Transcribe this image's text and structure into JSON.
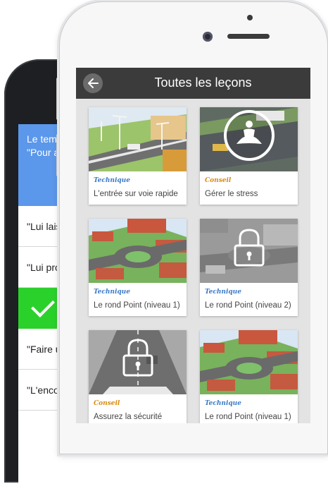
{
  "colors": {
    "technique": "#3b7bc6",
    "conseil": "#d98a12",
    "appbar": "#3b3b3b",
    "correct": "#2bd12b",
    "question_bg": "#5b97ea"
  },
  "back_phone": {
    "question_line1": "Le temp",
    "question_line2": "\"Pour ap",
    "answers": [
      "\"Lui lais",
      "\"Lui prop",
      "",
      "\"Faire u",
      "\"L'encou"
    ]
  },
  "app": {
    "title": "Toutes les leçons",
    "back_icon": "arrow-left-icon",
    "lessons": [
      {
        "tag": "Technique",
        "title": "L'entrée sur voie rapide",
        "locked": false,
        "icon": ""
      },
      {
        "tag": "Conseil",
        "title": "Gérer le stress",
        "locked": false,
        "icon": "meditation-icon"
      },
      {
        "tag": "Technique",
        "title": "Le rond Point (niveau 1)",
        "locked": false,
        "icon": ""
      },
      {
        "tag": "Technique",
        "title": "Le rond Point (niveau 2)",
        "locked": true,
        "icon": "lock-icon"
      },
      {
        "tag": "Conseil",
        "title": "Assurez la sécurité",
        "locked": true,
        "icon": "lock-icon"
      },
      {
        "tag": "Technique",
        "title": "Le rond Point (niveau 1)",
        "locked": false,
        "icon": ""
      }
    ]
  }
}
